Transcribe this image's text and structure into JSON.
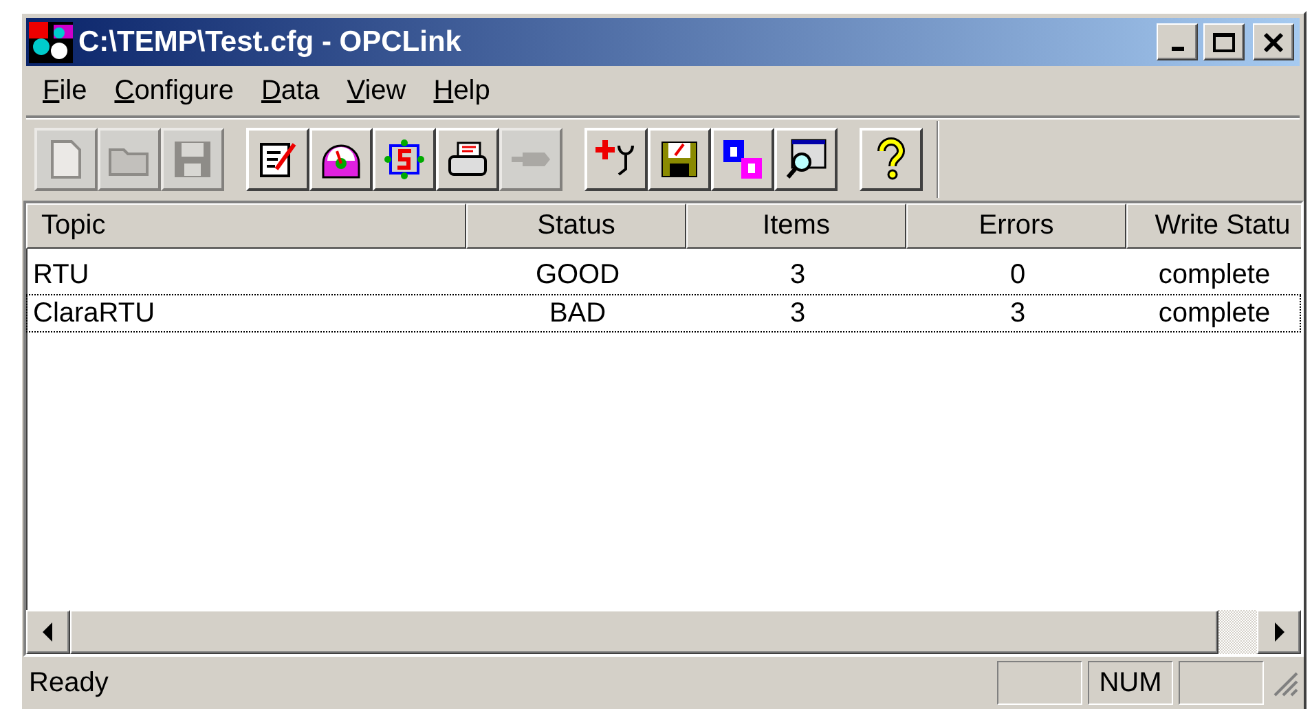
{
  "window": {
    "title": "C:\\TEMP\\Test.cfg - OPCLink"
  },
  "menu": [
    "File",
    "Configure",
    "Data",
    "View",
    "Help"
  ],
  "toolbar": [
    [
      {
        "kind": "new",
        "disabled": true
      },
      {
        "kind": "open",
        "disabled": true
      },
      {
        "kind": "save",
        "disabled": true
      }
    ],
    [
      {
        "kind": "edit",
        "disabled": false
      },
      {
        "kind": "gauge",
        "disabled": false
      },
      {
        "kind": "refresh",
        "disabled": false
      },
      {
        "kind": "print",
        "disabled": false
      },
      {
        "kind": "plug",
        "disabled": true
      }
    ],
    [
      {
        "kind": "diagnose",
        "disabled": false
      },
      {
        "kind": "disk",
        "disabled": false
      },
      {
        "kind": "database",
        "disabled": false
      },
      {
        "kind": "monitor",
        "disabled": false
      }
    ],
    [
      {
        "kind": "help",
        "disabled": false
      }
    ]
  ],
  "table": {
    "columns": [
      "Topic",
      "Status",
      "Items",
      "Errors",
      "Write Statu"
    ],
    "rows": [
      {
        "cells": [
          "RTU",
          "GOOD",
          "3",
          "0",
          "complete"
        ],
        "focused": false
      },
      {
        "cells": [
          "ClaraRTU",
          "BAD",
          "3",
          "3",
          "complete"
        ],
        "focused": true
      }
    ]
  },
  "status_bar": {
    "text": "Ready",
    "indicators": [
      "NUM"
    ]
  }
}
